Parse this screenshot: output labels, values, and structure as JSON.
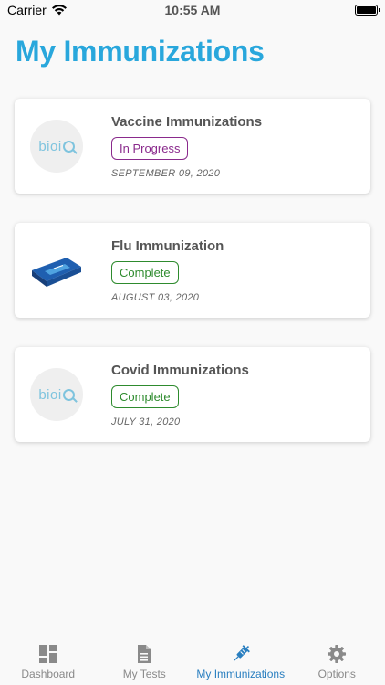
{
  "status_bar": {
    "carrier": "Carrier",
    "time": "10:55 AM"
  },
  "page": {
    "title": "My Immunizations"
  },
  "immunizations": [
    {
      "title": "Vaccine Immunizations",
      "status": "In Progress",
      "status_type": "progress",
      "date": "SEPTEMBER 09, 2020",
      "thumb_text": "bioi"
    },
    {
      "title": "Flu Immunization",
      "status": "Complete",
      "status_type": "complete",
      "date": "AUGUST 03, 2020",
      "thumb_text": ""
    },
    {
      "title": "Covid Immunizations",
      "status": "Complete",
      "status_type": "complete",
      "date": "JULY 31, 2020",
      "thumb_text": "bioi"
    }
  ],
  "tabs": [
    {
      "label": "Dashboard",
      "icon": "dashboard-icon",
      "active": false
    },
    {
      "label": "My Tests",
      "icon": "document-icon",
      "active": false
    },
    {
      "label": "My Immunizations",
      "icon": "syringe-icon",
      "active": true
    },
    {
      "label": "Options",
      "icon": "gear-icon",
      "active": false
    }
  ],
  "colors": {
    "accent": "#29a7dc",
    "active_tab": "#2a7fc0",
    "in_progress": "#8a2a8c",
    "complete": "#2e8b2e"
  }
}
